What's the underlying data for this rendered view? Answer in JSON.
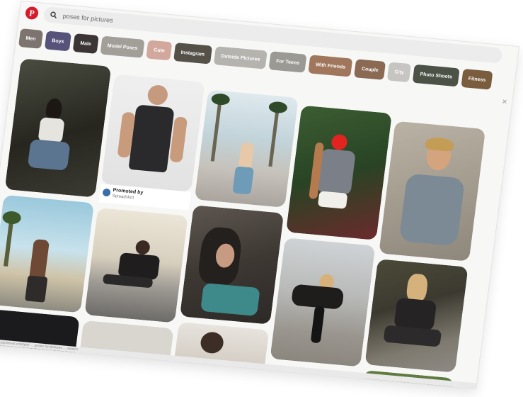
{
  "app": {
    "logo_glyph": "P"
  },
  "search": {
    "value": "poses for pictures",
    "icon": "search-icon"
  },
  "chips": [
    {
      "label": "Men",
      "color": "#7d7470"
    },
    {
      "label": "Boys",
      "color": "#56527a"
    },
    {
      "label": "Male",
      "color": "#3b3535"
    },
    {
      "label": "Model Poses",
      "color": "#a29e98"
    },
    {
      "label": "Cute",
      "color": "#d2a89c"
    },
    {
      "label": "Instagram",
      "color": "#555148"
    },
    {
      "label": "Outside Pictures",
      "color": "#b5b3ae"
    },
    {
      "label": "For Teens",
      "color": "#9a9993"
    },
    {
      "label": "With Friends",
      "color": "#a0775c"
    },
    {
      "label": "Couple",
      "color": "#8a6a52"
    },
    {
      "label": "City",
      "color": "#c7c5c2"
    },
    {
      "label": "Photo Shoots",
      "color": "#4c5246"
    },
    {
      "label": "Fitness",
      "color": "#7a5d3e"
    }
  ],
  "promoted": {
    "label": "Promoted by",
    "by": "Spreadshirt"
  },
  "status_text": "https://www.pinterest.com/pin/ ... poses for pictures ... search",
  "colors": {
    "logo": "#d61b2a",
    "window_bg": "#f7f7f6"
  }
}
